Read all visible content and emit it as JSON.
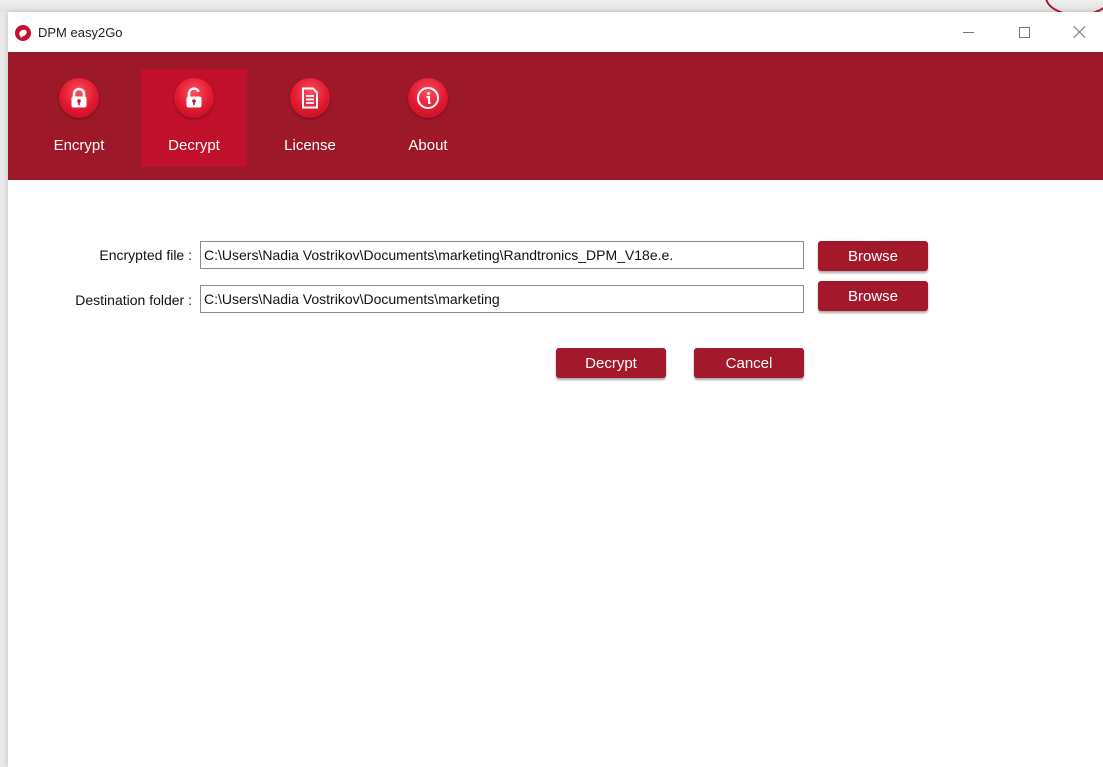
{
  "window": {
    "title": "DPM easy2Go",
    "minimize_label": "—",
    "maximize_label": "☐",
    "close_label": "✕"
  },
  "ribbon": {
    "tabs": [
      {
        "label": "Encrypt",
        "icon": "lock-closed-icon",
        "active": false
      },
      {
        "label": "Decrypt",
        "icon": "lock-open-icon",
        "active": true
      },
      {
        "label": "License",
        "icon": "document-icon",
        "active": false
      },
      {
        "label": "About",
        "icon": "info-icon",
        "active": false
      }
    ],
    "accent_color": "#9d1829",
    "active_color": "#c0102b"
  },
  "form": {
    "encrypted_file_label": "Encrypted file :",
    "encrypted_file_value": "C:\\Users\\Nadia Vostrikov\\Documents\\marketing\\Randtronics_DPM_V18e.e.",
    "destination_folder_label": "Destination folder :",
    "destination_folder_value": "C:\\Users\\Nadia Vostrikov\\Documents\\marketing",
    "browse_label": "Browse",
    "decrypt_label": "Decrypt",
    "cancel_label": "Cancel"
  }
}
